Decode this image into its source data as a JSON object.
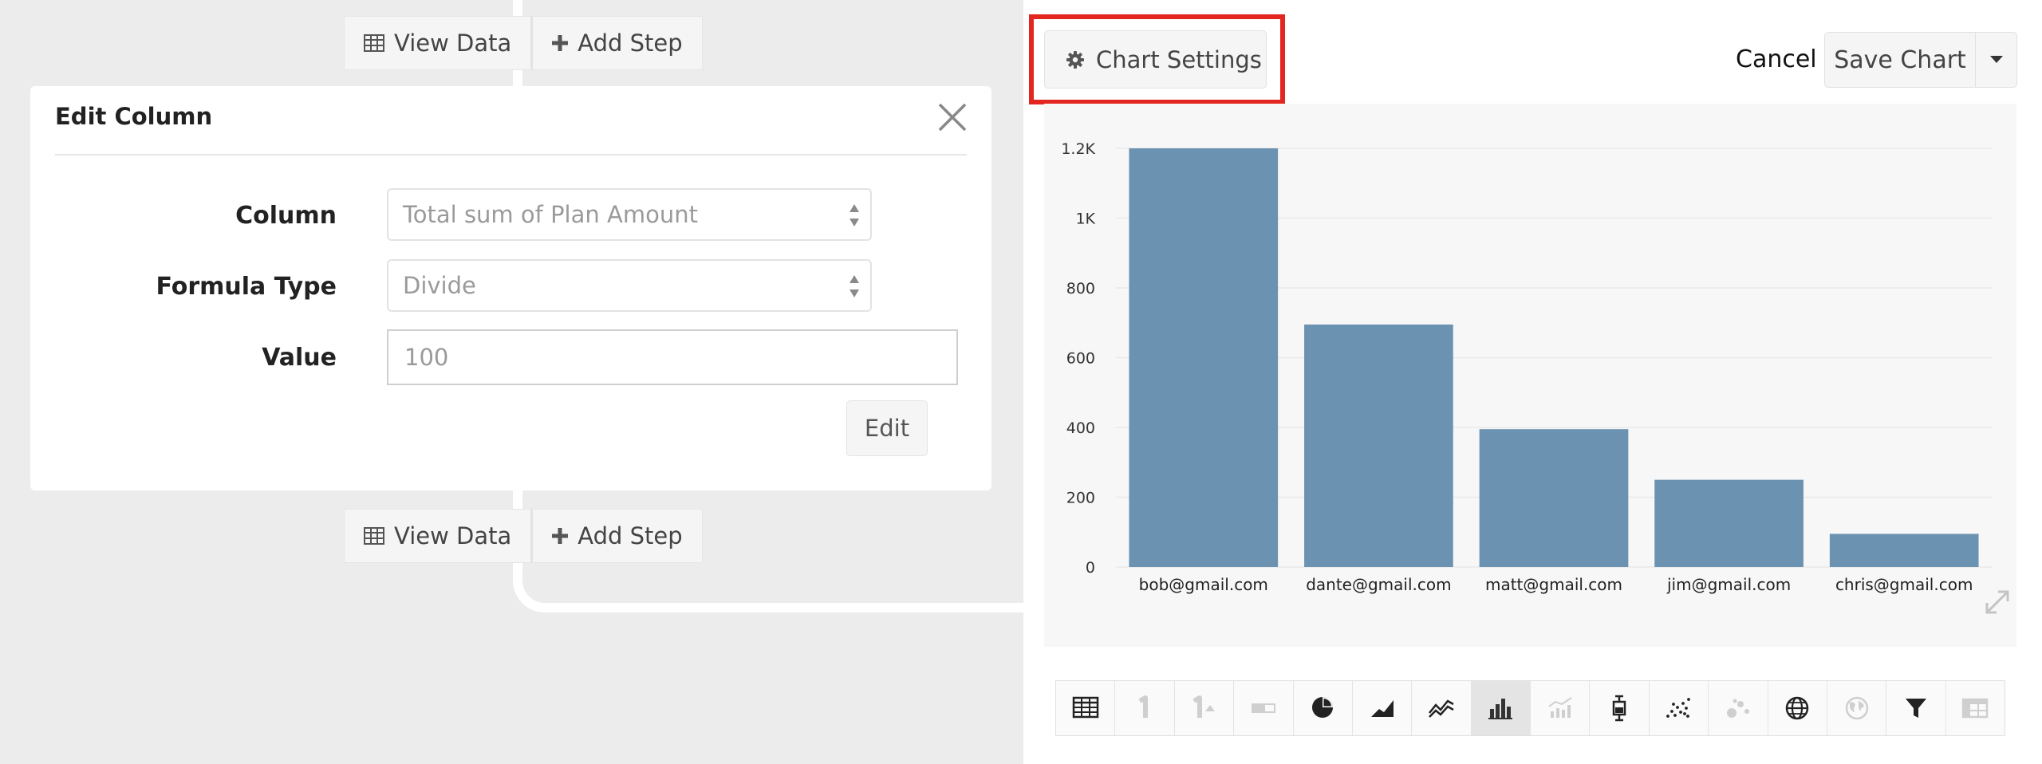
{
  "pipeline": {
    "top_step": {
      "view_data": "View Data",
      "add_step": "Add Step"
    },
    "bottom_step": {
      "view_data": "View Data",
      "add_step": "Add Step"
    },
    "edit_column": {
      "title": "Edit Column",
      "fields": [
        {
          "label": "Column",
          "type": "select",
          "value": "Total sum of Plan Amount"
        },
        {
          "label": "Formula Type",
          "type": "select",
          "value": "Divide"
        },
        {
          "label": "Value",
          "type": "input",
          "placeholder": "100"
        }
      ],
      "submit_label": "Edit"
    }
  },
  "chart_header": {
    "settings_label": "Chart Settings",
    "cancel_label": "Cancel",
    "save_label": "Save Chart",
    "highlight_color": "#e3261f"
  },
  "chart_data": {
    "type": "bar",
    "categories": [
      "bob@gmail.com",
      "dante@gmail.com",
      "matt@gmail.com",
      "jim@gmail.com",
      "chris@gmail.com"
    ],
    "values": [
      1200,
      695,
      395,
      250,
      95
    ],
    "y_ticks": [
      "0",
      "200",
      "400",
      "600",
      "800",
      "1K",
      "1.2K"
    ],
    "y_tick_values": [
      0,
      200,
      400,
      600,
      800,
      1000,
      1200
    ],
    "ylim": [
      0,
      1200
    ],
    "grid": true,
    "bar_color": "#6b92b0",
    "title": "",
    "xlabel": "",
    "ylabel": ""
  },
  "chart_types": [
    {
      "icon": "table-icon",
      "active": false,
      "enabled": true
    },
    {
      "icon": "single-number-icon",
      "active": false,
      "enabled": false
    },
    {
      "icon": "number-trend-icon",
      "active": false,
      "enabled": false
    },
    {
      "icon": "progress-icon",
      "active": false,
      "enabled": false
    },
    {
      "icon": "pie-icon",
      "active": false,
      "enabled": true
    },
    {
      "icon": "area-icon",
      "active": false,
      "enabled": true
    },
    {
      "icon": "line-icon",
      "active": false,
      "enabled": true
    },
    {
      "icon": "bar-icon",
      "active": true,
      "enabled": true
    },
    {
      "icon": "combo-icon",
      "active": false,
      "enabled": false
    },
    {
      "icon": "boxplot-icon",
      "active": false,
      "enabled": true
    },
    {
      "icon": "scatter-icon",
      "active": false,
      "enabled": true
    },
    {
      "icon": "bubble-icon",
      "active": false,
      "enabled": false
    },
    {
      "icon": "globe-icon",
      "active": false,
      "enabled": true
    },
    {
      "icon": "globe-regions-icon",
      "active": false,
      "enabled": false
    },
    {
      "icon": "funnel-icon",
      "active": false,
      "enabled": true
    },
    {
      "icon": "pivot-table-icon",
      "active": false,
      "enabled": false
    }
  ]
}
